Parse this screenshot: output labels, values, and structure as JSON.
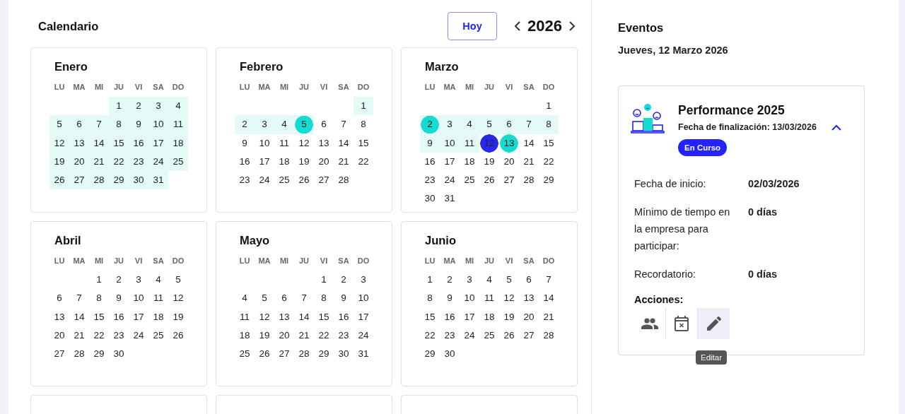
{
  "calendar": {
    "title": "Calendario",
    "today_button": "Hoy",
    "year": "2026",
    "months": [
      {
        "kind": "full",
        "name": "Enero",
        "weekdays": [
          "LU",
          "MA",
          "MI",
          "JU",
          "VI",
          "SA",
          "DO"
        ],
        "weeks": [
          [
            {
              "kind": "blank"
            },
            {
              "kind": "blank"
            },
            {
              "kind": "blank"
            },
            {
              "kind": "day",
              "text": "1",
              "range": true,
              "event": false,
              "today": false
            },
            {
              "kind": "day",
              "text": "2",
              "range": true,
              "event": false,
              "today": false
            },
            {
              "kind": "day",
              "text": "3",
              "range": true,
              "event": false,
              "today": false
            },
            {
              "kind": "day",
              "text": "4",
              "range": true,
              "event": false,
              "today": false
            }
          ],
          [
            {
              "kind": "day",
              "text": "5",
              "range": true,
              "event": false,
              "today": false
            },
            {
              "kind": "day",
              "text": "6",
              "range": true,
              "event": false,
              "today": false
            },
            {
              "kind": "day",
              "text": "7",
              "range": true,
              "event": false,
              "today": false
            },
            {
              "kind": "day",
              "text": "8",
              "range": true,
              "event": false,
              "today": false
            },
            {
              "kind": "day",
              "text": "9",
              "range": true,
              "event": false,
              "today": false
            },
            {
              "kind": "day",
              "text": "10",
              "range": true,
              "event": false,
              "today": false
            },
            {
              "kind": "day",
              "text": "11",
              "range": true,
              "event": false,
              "today": false
            }
          ],
          [
            {
              "kind": "day",
              "text": "12",
              "range": true,
              "event": false,
              "today": false
            },
            {
              "kind": "day",
              "text": "13",
              "range": true,
              "event": false,
              "today": false
            },
            {
              "kind": "day",
              "text": "14",
              "range": true,
              "event": false,
              "today": false
            },
            {
              "kind": "day",
              "text": "15",
              "range": true,
              "event": false,
              "today": false
            },
            {
              "kind": "day",
              "text": "16",
              "range": true,
              "event": false,
              "today": false
            },
            {
              "kind": "day",
              "text": "17",
              "range": true,
              "event": false,
              "today": false
            },
            {
              "kind": "day",
              "text": "18",
              "range": true,
              "event": false,
              "today": false
            }
          ],
          [
            {
              "kind": "day",
              "text": "19",
              "range": true,
              "event": false,
              "today": false
            },
            {
              "kind": "day",
              "text": "20",
              "range": true,
              "event": false,
              "today": false
            },
            {
              "kind": "day",
              "text": "21",
              "range": true,
              "event": false,
              "today": false
            },
            {
              "kind": "day",
              "text": "22",
              "range": true,
              "event": false,
              "today": false
            },
            {
              "kind": "day",
              "text": "23",
              "range": true,
              "event": false,
              "today": false
            },
            {
              "kind": "day",
              "text": "24",
              "range": true,
              "event": false,
              "today": false
            },
            {
              "kind": "day",
              "text": "25",
              "range": true,
              "event": false,
              "today": false
            }
          ],
          [
            {
              "kind": "day",
              "text": "26",
              "range": true,
              "event": false,
              "today": false
            },
            {
              "kind": "day",
              "text": "27",
              "range": true,
              "event": false,
              "today": false
            },
            {
              "kind": "day",
              "text": "28",
              "range": true,
              "event": false,
              "today": false
            },
            {
              "kind": "day",
              "text": "29",
              "range": true,
              "event": false,
              "today": false
            },
            {
              "kind": "day",
              "text": "30",
              "range": true,
              "event": false,
              "today": false
            },
            {
              "kind": "day",
              "text": "31",
              "range": true,
              "event": false,
              "today": false
            }
          ]
        ]
      },
      {
        "kind": "full",
        "name": "Febrero",
        "weekdays": [
          "LU",
          "MA",
          "MI",
          "JU",
          "VI",
          "SA",
          "DO"
        ],
        "weeks": [
          [
            {
              "kind": "blank"
            },
            {
              "kind": "blank"
            },
            {
              "kind": "blank"
            },
            {
              "kind": "blank"
            },
            {
              "kind": "blank"
            },
            {
              "kind": "blank"
            },
            {
              "kind": "day",
              "text": "1",
              "range": true,
              "event": false,
              "today": false
            }
          ],
          [
            {
              "kind": "day",
              "text": "2",
              "range": true,
              "event": false,
              "today": false
            },
            {
              "kind": "day",
              "text": "3",
              "range": true,
              "event": false,
              "today": false
            },
            {
              "kind": "day",
              "text": "4",
              "range": true,
              "event": false,
              "today": false
            },
            {
              "kind": "day",
              "text": "5",
              "range": true,
              "event": true,
              "today": false
            },
            {
              "kind": "day",
              "text": "6",
              "range": false,
              "event": false,
              "today": false
            },
            {
              "kind": "day",
              "text": "7",
              "range": false,
              "event": false,
              "today": false
            },
            {
              "kind": "day",
              "text": "8",
              "range": false,
              "event": false,
              "today": false
            }
          ],
          [
            {
              "kind": "day",
              "text": "9",
              "range": false,
              "event": false,
              "today": false
            },
            {
              "kind": "day",
              "text": "10",
              "range": false,
              "event": false,
              "today": false
            },
            {
              "kind": "day",
              "text": "11",
              "range": false,
              "event": false,
              "today": false
            },
            {
              "kind": "day",
              "text": "12",
              "range": false,
              "event": false,
              "today": false
            },
            {
              "kind": "day",
              "text": "13",
              "range": false,
              "event": false,
              "today": false
            },
            {
              "kind": "day",
              "text": "14",
              "range": false,
              "event": false,
              "today": false
            },
            {
              "kind": "day",
              "text": "15",
              "range": false,
              "event": false,
              "today": false
            }
          ],
          [
            {
              "kind": "day",
              "text": "16",
              "range": false,
              "event": false,
              "today": false
            },
            {
              "kind": "day",
              "text": "17",
              "range": false,
              "event": false,
              "today": false
            },
            {
              "kind": "day",
              "text": "18",
              "range": false,
              "event": false,
              "today": false
            },
            {
              "kind": "day",
              "text": "19",
              "range": false,
              "event": false,
              "today": false
            },
            {
              "kind": "day",
              "text": "20",
              "range": false,
              "event": false,
              "today": false
            },
            {
              "kind": "day",
              "text": "21",
              "range": false,
              "event": false,
              "today": false
            },
            {
              "kind": "day",
              "text": "22",
              "range": false,
              "event": false,
              "today": false
            }
          ],
          [
            {
              "kind": "day",
              "text": "23",
              "range": false,
              "event": false,
              "today": false
            },
            {
              "kind": "day",
              "text": "24",
              "range": false,
              "event": false,
              "today": false
            },
            {
              "kind": "day",
              "text": "25",
              "range": false,
              "event": false,
              "today": false
            },
            {
              "kind": "day",
              "text": "26",
              "range": false,
              "event": false,
              "today": false
            },
            {
              "kind": "day",
              "text": "27",
              "range": false,
              "event": false,
              "today": false
            },
            {
              "kind": "day",
              "text": "28",
              "range": false,
              "event": false,
              "today": false
            }
          ]
        ]
      },
      {
        "kind": "full",
        "name": "Marzo",
        "weekdays": [
          "LU",
          "MA",
          "MI",
          "JU",
          "VI",
          "SA",
          "DO"
        ],
        "weeks": [
          [
            {
              "kind": "blank"
            },
            {
              "kind": "blank"
            },
            {
              "kind": "blank"
            },
            {
              "kind": "blank"
            },
            {
              "kind": "blank"
            },
            {
              "kind": "blank"
            },
            {
              "kind": "day",
              "text": "1",
              "range": false,
              "event": false,
              "today": false
            }
          ],
          [
            {
              "kind": "day",
              "text": "2",
              "range": true,
              "event": true,
              "today": false
            },
            {
              "kind": "day",
              "text": "3",
              "range": true,
              "event": false,
              "today": false
            },
            {
              "kind": "day",
              "text": "4",
              "range": true,
              "event": false,
              "today": false
            },
            {
              "kind": "day",
              "text": "5",
              "range": true,
              "event": false,
              "today": false
            },
            {
              "kind": "day",
              "text": "6",
              "range": true,
              "event": false,
              "today": false
            },
            {
              "kind": "day",
              "text": "7",
              "range": true,
              "event": false,
              "today": false
            },
            {
              "kind": "day",
              "text": "8",
              "range": true,
              "event": false,
              "today": false
            }
          ],
          [
            {
              "kind": "day",
              "text": "9",
              "range": true,
              "event": false,
              "today": false
            },
            {
              "kind": "day",
              "text": "10",
              "range": true,
              "event": false,
              "today": false
            },
            {
              "kind": "day",
              "text": "11",
              "range": true,
              "event": false,
              "today": false
            },
            {
              "kind": "day",
              "text": "12",
              "range": false,
              "event": false,
              "today": true
            },
            {
              "kind": "day",
              "text": "13",
              "range": false,
              "event": true,
              "today": false
            },
            {
              "kind": "day",
              "text": "14",
              "range": false,
              "event": false,
              "today": false
            },
            {
              "kind": "day",
              "text": "15",
              "range": false,
              "event": false,
              "today": false
            }
          ],
          [
            {
              "kind": "day",
              "text": "16",
              "range": false,
              "event": false,
              "today": false
            },
            {
              "kind": "day",
              "text": "17",
              "range": false,
              "event": false,
              "today": false
            },
            {
              "kind": "day",
              "text": "18",
              "range": false,
              "event": false,
              "today": false
            },
            {
              "kind": "day",
              "text": "19",
              "range": false,
              "event": false,
              "today": false
            },
            {
              "kind": "day",
              "text": "20",
              "range": false,
              "event": false,
              "today": false
            },
            {
              "kind": "day",
              "text": "21",
              "range": false,
              "event": false,
              "today": false
            },
            {
              "kind": "day",
              "text": "22",
              "range": false,
              "event": false,
              "today": false
            }
          ],
          [
            {
              "kind": "day",
              "text": "23",
              "range": false,
              "event": false,
              "today": false
            },
            {
              "kind": "day",
              "text": "24",
              "range": false,
              "event": false,
              "today": false
            },
            {
              "kind": "day",
              "text": "25",
              "range": false,
              "event": false,
              "today": false
            },
            {
              "kind": "day",
              "text": "26",
              "range": false,
              "event": false,
              "today": false
            },
            {
              "kind": "day",
              "text": "27",
              "range": false,
              "event": false,
              "today": false
            },
            {
              "kind": "day",
              "text": "28",
              "range": false,
              "event": false,
              "today": false
            },
            {
              "kind": "day",
              "text": "29",
              "range": false,
              "event": false,
              "today": false
            }
          ],
          [
            {
              "kind": "day",
              "text": "30",
              "range": false,
              "event": false,
              "today": false
            },
            {
              "kind": "day",
              "text": "31",
              "range": false,
              "event": false,
              "today": false
            }
          ]
        ]
      },
      {
        "kind": "full",
        "name": "Abril",
        "weekdays": [
          "LU",
          "MA",
          "MI",
          "JU",
          "VI",
          "SA",
          "DO"
        ],
        "weeks": [
          [
            {
              "kind": "blank"
            },
            {
              "kind": "blank"
            },
            {
              "kind": "day",
              "text": "1",
              "range": false,
              "event": false,
              "today": false
            },
            {
              "kind": "day",
              "text": "2",
              "range": false,
              "event": false,
              "today": false
            },
            {
              "kind": "day",
              "text": "3",
              "range": false,
              "event": false,
              "today": false
            },
            {
              "kind": "day",
              "text": "4",
              "range": false,
              "event": false,
              "today": false
            },
            {
              "kind": "day",
              "text": "5",
              "range": false,
              "event": false,
              "today": false
            }
          ],
          [
            {
              "kind": "day",
              "text": "6",
              "range": false,
              "event": false,
              "today": false
            },
            {
              "kind": "day",
              "text": "7",
              "range": false,
              "event": false,
              "today": false
            },
            {
              "kind": "day",
              "text": "8",
              "range": false,
              "event": false,
              "today": false
            },
            {
              "kind": "day",
              "text": "9",
              "range": false,
              "event": false,
              "today": false
            },
            {
              "kind": "day",
              "text": "10",
              "range": false,
              "event": false,
              "today": false
            },
            {
              "kind": "day",
              "text": "11",
              "range": false,
              "event": false,
              "today": false
            },
            {
              "kind": "day",
              "text": "12",
              "range": false,
              "event": false,
              "today": false
            }
          ],
          [
            {
              "kind": "day",
              "text": "13",
              "range": false,
              "event": false,
              "today": false
            },
            {
              "kind": "day",
              "text": "14",
              "range": false,
              "event": false,
              "today": false
            },
            {
              "kind": "day",
              "text": "15",
              "range": false,
              "event": false,
              "today": false
            },
            {
              "kind": "day",
              "text": "16",
              "range": false,
              "event": false,
              "today": false
            },
            {
              "kind": "day",
              "text": "17",
              "range": false,
              "event": false,
              "today": false
            },
            {
              "kind": "day",
              "text": "18",
              "range": false,
              "event": false,
              "today": false
            },
            {
              "kind": "day",
              "text": "19",
              "range": false,
              "event": false,
              "today": false
            }
          ],
          [
            {
              "kind": "day",
              "text": "20",
              "range": false,
              "event": false,
              "today": false
            },
            {
              "kind": "day",
              "text": "21",
              "range": false,
              "event": false,
              "today": false
            },
            {
              "kind": "day",
              "text": "22",
              "range": false,
              "event": false,
              "today": false
            },
            {
              "kind": "day",
              "text": "23",
              "range": false,
              "event": false,
              "today": false
            },
            {
              "kind": "day",
              "text": "24",
              "range": false,
              "event": false,
              "today": false
            },
            {
              "kind": "day",
              "text": "25",
              "range": false,
              "event": false,
              "today": false
            },
            {
              "kind": "day",
              "text": "26",
              "range": false,
              "event": false,
              "today": false
            }
          ],
          [
            {
              "kind": "day",
              "text": "27",
              "range": false,
              "event": false,
              "today": false
            },
            {
              "kind": "day",
              "text": "28",
              "range": false,
              "event": false,
              "today": false
            },
            {
              "kind": "day",
              "text": "29",
              "range": false,
              "event": false,
              "today": false
            },
            {
              "kind": "day",
              "text": "30",
              "range": false,
              "event": false,
              "today": false
            }
          ]
        ]
      },
      {
        "kind": "full",
        "name": "Mayo",
        "weekdays": [
          "LU",
          "MA",
          "MI",
          "JU",
          "VI",
          "SA",
          "DO"
        ],
        "weeks": [
          [
            {
              "kind": "blank"
            },
            {
              "kind": "blank"
            },
            {
              "kind": "blank"
            },
            {
              "kind": "blank"
            },
            {
              "kind": "day",
              "text": "1",
              "range": false,
              "event": false,
              "today": false
            },
            {
              "kind": "day",
              "text": "2",
              "range": false,
              "event": false,
              "today": false
            },
            {
              "kind": "day",
              "text": "3",
              "range": false,
              "event": false,
              "today": false
            }
          ],
          [
            {
              "kind": "day",
              "text": "4",
              "range": false,
              "event": false,
              "today": false
            },
            {
              "kind": "day",
              "text": "5",
              "range": false,
              "event": false,
              "today": false
            },
            {
              "kind": "day",
              "text": "6",
              "range": false,
              "event": false,
              "today": false
            },
            {
              "kind": "day",
              "text": "7",
              "range": false,
              "event": false,
              "today": false
            },
            {
              "kind": "day",
              "text": "8",
              "range": false,
              "event": false,
              "today": false
            },
            {
              "kind": "day",
              "text": "9",
              "range": false,
              "event": false,
              "today": false
            },
            {
              "kind": "day",
              "text": "10",
              "range": false,
              "event": false,
              "today": false
            }
          ],
          [
            {
              "kind": "day",
              "text": "11",
              "range": false,
              "event": false,
              "today": false
            },
            {
              "kind": "day",
              "text": "12",
              "range": false,
              "event": false,
              "today": false
            },
            {
              "kind": "day",
              "text": "13",
              "range": false,
              "event": false,
              "today": false
            },
            {
              "kind": "day",
              "text": "14",
              "range": false,
              "event": false,
              "today": false
            },
            {
              "kind": "day",
              "text": "15",
              "range": false,
              "event": false,
              "today": false
            },
            {
              "kind": "day",
              "text": "16",
              "range": false,
              "event": false,
              "today": false
            },
            {
              "kind": "day",
              "text": "17",
              "range": false,
              "event": false,
              "today": false
            }
          ],
          [
            {
              "kind": "day",
              "text": "18",
              "range": false,
              "event": false,
              "today": false
            },
            {
              "kind": "day",
              "text": "19",
              "range": false,
              "event": false,
              "today": false
            },
            {
              "kind": "day",
              "text": "20",
              "range": false,
              "event": false,
              "today": false
            },
            {
              "kind": "day",
              "text": "21",
              "range": false,
              "event": false,
              "today": false
            },
            {
              "kind": "day",
              "text": "22",
              "range": false,
              "event": false,
              "today": false
            },
            {
              "kind": "day",
              "text": "23",
              "range": false,
              "event": false,
              "today": false
            },
            {
              "kind": "day",
              "text": "24",
              "range": false,
              "event": false,
              "today": false
            }
          ],
          [
            {
              "kind": "day",
              "text": "25",
              "range": false,
              "event": false,
              "today": false
            },
            {
              "kind": "day",
              "text": "26",
              "range": false,
              "event": false,
              "today": false
            },
            {
              "kind": "day",
              "text": "27",
              "range": false,
              "event": false,
              "today": false
            },
            {
              "kind": "day",
              "text": "28",
              "range": false,
              "event": false,
              "today": false
            },
            {
              "kind": "day",
              "text": "29",
              "range": false,
              "event": false,
              "today": false
            },
            {
              "kind": "day",
              "text": "30",
              "range": false,
              "event": false,
              "today": false
            },
            {
              "kind": "day",
              "text": "31",
              "range": false,
              "event": false,
              "today": false
            }
          ]
        ]
      },
      {
        "kind": "full",
        "name": "Junio",
        "weekdays": [
          "LU",
          "MA",
          "MI",
          "JU",
          "VI",
          "SA",
          "DO"
        ],
        "weeks": [
          [
            {
              "kind": "day",
              "text": "1",
              "range": false,
              "event": false,
              "today": false
            },
            {
              "kind": "day",
              "text": "2",
              "range": false,
              "event": false,
              "today": false
            },
            {
              "kind": "day",
              "text": "3",
              "range": false,
              "event": false,
              "today": false
            },
            {
              "kind": "day",
              "text": "4",
              "range": false,
              "event": false,
              "today": false
            },
            {
              "kind": "day",
              "text": "5",
              "range": false,
              "event": false,
              "today": false
            },
            {
              "kind": "day",
              "text": "6",
              "range": false,
              "event": false,
              "today": false
            },
            {
              "kind": "day",
              "text": "7",
              "range": false,
              "event": false,
              "today": false
            }
          ],
          [
            {
              "kind": "day",
              "text": "8",
              "range": false,
              "event": false,
              "today": false
            },
            {
              "kind": "day",
              "text": "9",
              "range": false,
              "event": false,
              "today": false
            },
            {
              "kind": "day",
              "text": "10",
              "range": false,
              "event": false,
              "today": false
            },
            {
              "kind": "day",
              "text": "11",
              "range": false,
              "event": false,
              "today": false
            },
            {
              "kind": "day",
              "text": "12",
              "range": false,
              "event": false,
              "today": false
            },
            {
              "kind": "day",
              "text": "13",
              "range": false,
              "event": false,
              "today": false
            },
            {
              "kind": "day",
              "text": "14",
              "range": false,
              "event": false,
              "today": false
            }
          ],
          [
            {
              "kind": "day",
              "text": "15",
              "range": false,
              "event": false,
              "today": false
            },
            {
              "kind": "day",
              "text": "16",
              "range": false,
              "event": false,
              "today": false
            },
            {
              "kind": "day",
              "text": "17",
              "range": false,
              "event": false,
              "today": false
            },
            {
              "kind": "day",
              "text": "18",
              "range": false,
              "event": false,
              "today": false
            },
            {
              "kind": "day",
              "text": "19",
              "range": false,
              "event": false,
              "today": false
            },
            {
              "kind": "day",
              "text": "20",
              "range": false,
              "event": false,
              "today": false
            },
            {
              "kind": "day",
              "text": "21",
              "range": false,
              "event": false,
              "today": false
            }
          ],
          [
            {
              "kind": "day",
              "text": "22",
              "range": false,
              "event": false,
              "today": false
            },
            {
              "kind": "day",
              "text": "23",
              "range": false,
              "event": false,
              "today": false
            },
            {
              "kind": "day",
              "text": "24",
              "range": false,
              "event": false,
              "today": false
            },
            {
              "kind": "day",
              "text": "25",
              "range": false,
              "event": false,
              "today": false
            },
            {
              "kind": "day",
              "text": "26",
              "range": false,
              "event": false,
              "today": false
            },
            {
              "kind": "day",
              "text": "27",
              "range": false,
              "event": false,
              "today": false
            },
            {
              "kind": "day",
              "text": "28",
              "range": false,
              "event": false,
              "today": false
            }
          ],
          [
            {
              "kind": "day",
              "text": "29",
              "range": false,
              "event": false,
              "today": false
            },
            {
              "kind": "day",
              "text": "30",
              "range": false,
              "event": false,
              "today": false
            }
          ]
        ]
      },
      {
        "kind": "cut"
      },
      {
        "kind": "cut"
      },
      {
        "kind": "cut"
      }
    ]
  },
  "events": {
    "title": "Eventos",
    "date": "Jueves, 12 Marzo 2026",
    "items": [
      {
        "title": "Performance 2025",
        "end_date": "Fecha de finalización: 13/03/2026",
        "expanded": true,
        "status": "En Curso",
        "details": [
          {
            "label": "Fecha de inicio:",
            "value": "02/03/2026"
          },
          {
            "label": "Mínimo de tiempo en la empresa para participar:",
            "value": "0 días"
          },
          {
            "label": "Recordatorio:",
            "value": "0 días"
          }
        ],
        "actions_label": "Acciones:",
        "actions": [
          {
            "kind": "participants",
            "hovered": false
          },
          {
            "kind": "cancel-date",
            "hovered": false
          },
          {
            "kind": "edit",
            "hovered": true,
            "tooltip": "Editar"
          }
        ]
      }
    ]
  }
}
